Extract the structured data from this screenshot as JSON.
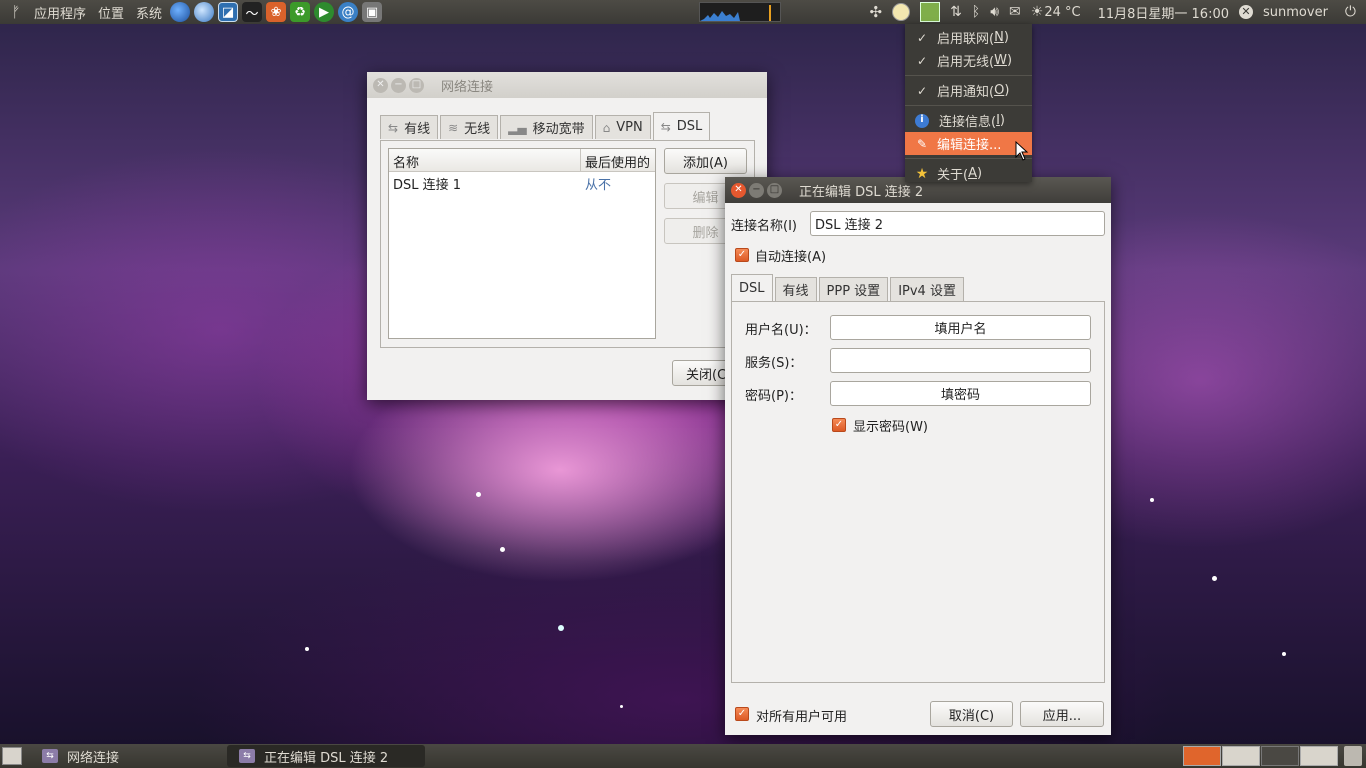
{
  "top_panel": {
    "menus": [
      "应用程序",
      "位置",
      "系统"
    ],
    "launchers": [
      "earth-icon",
      "globe-icon",
      "chart-icon",
      "wave-icon",
      "panda-icon",
      "recycle-icon",
      "play-icon",
      "spiral-icon",
      "camera-icon"
    ],
    "weather": "24 °C",
    "clock": "11月8日星期一 16:00",
    "user": "sunmover"
  },
  "indicator_menu": {
    "items": [
      {
        "lead": "✓",
        "label": "启用联网(",
        "key": "N",
        "suffix": ")"
      },
      {
        "lead": "✓",
        "label": "启用无线(",
        "key": "W",
        "suffix": ")"
      },
      {
        "lead": "✓",
        "label": "启用通知(",
        "key": "O",
        "suffix": ")"
      },
      {
        "lead": "i",
        "label": "连接信息(",
        "key": "I",
        "suffix": ")"
      },
      {
        "lead": "✎",
        "label": "编辑连接...",
        "key": "",
        "suffix": ""
      },
      {
        "lead": "★",
        "label": "关于(",
        "key": "A",
        "suffix": ")"
      }
    ]
  },
  "network_window": {
    "title": "网络连接",
    "tabs": [
      "有线",
      "无线",
      "移动宽带",
      "VPN",
      "DSL"
    ],
    "selected_tab": "DSL",
    "columns": [
      "名称",
      "最后使用的"
    ],
    "rows": [
      {
        "name": "DSL 连接 1",
        "last_used": "从不"
      }
    ],
    "buttons": {
      "add": "添加(A)",
      "edit": "编辑",
      "delete": "删除",
      "close": "关闭(C)"
    }
  },
  "edit_window": {
    "title": "正在编辑 DSL 连接 2",
    "conn_name_label": "连接名称(I)",
    "conn_name_value": "DSL 连接 2",
    "auto_connect_label": "自动连接(A)",
    "tabs": [
      "DSL",
      "有线",
      "PPP 设置",
      "IPv4 设置"
    ],
    "selected_tab": "DSL",
    "username_label": "用户名(U)：",
    "username_value": "填用户名",
    "service_label": "服务(S)：",
    "service_value": "",
    "password_label": "密码(P)：",
    "password_value": "填密码",
    "show_password_label": "显示密码(W)",
    "all_users_label": "对所有用户可用",
    "cancel_button": "取消(C)",
    "apply_button": "应用..."
  },
  "bottom_panel": {
    "tasks": [
      "网络连接",
      "正在编辑 DSL 连接 2"
    ]
  },
  "colors": {
    "accent": "#f07746",
    "panel": "#3c3b37",
    "link": "#4a72a8"
  }
}
